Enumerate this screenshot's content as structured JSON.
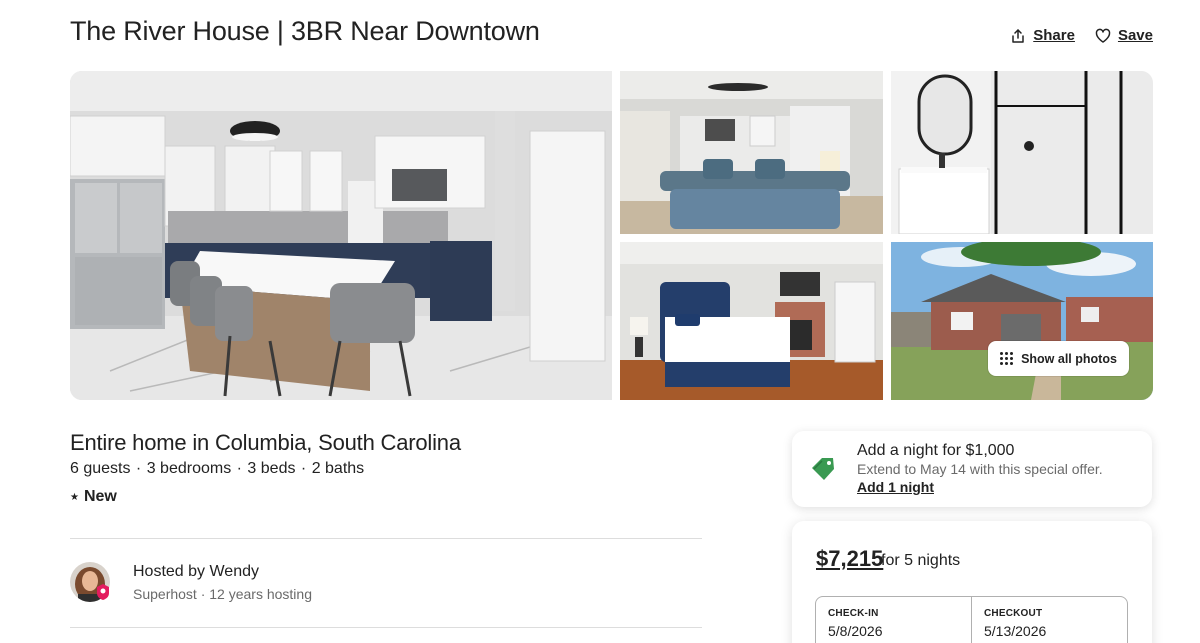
{
  "header": {
    "title": "The River House | 3BR Near Downtown",
    "share_label": "Share",
    "save_label": "Save"
  },
  "gallery": {
    "show_all_label": "Show all photos",
    "photos": [
      "kitchen",
      "living-room",
      "bathroom",
      "bedroom",
      "house-exterior"
    ]
  },
  "listing": {
    "type": "Entire home in Columbia, South Carolina",
    "guests": "6 guests",
    "bedrooms": "3 bedrooms",
    "beds": "3 beds",
    "baths": "2 baths",
    "separator": " · ",
    "new_label": "New"
  },
  "host": {
    "name": "Hosted by Wendy",
    "subtitle": "Superhost · 12 years hosting"
  },
  "offer": {
    "title": "Add a night for $1,000",
    "subtitle": "Extend to May 14 with this special offer.",
    "link": "Add 1 night",
    "icon": "price-tag-icon",
    "icon_color": "#3a9a52"
  },
  "booking": {
    "price": "$7,215",
    "price_suffix": "for 5 nights",
    "checkin_label": "CHECK-IN",
    "checkin_value": "5/8/2026",
    "checkout_label": "CHECKOUT",
    "checkout_value": "5/13/2026"
  },
  "colors": {
    "text": "#222222",
    "muted": "#6a6a6a",
    "divider": "#dddddd",
    "superhost": "#e31c5f"
  }
}
